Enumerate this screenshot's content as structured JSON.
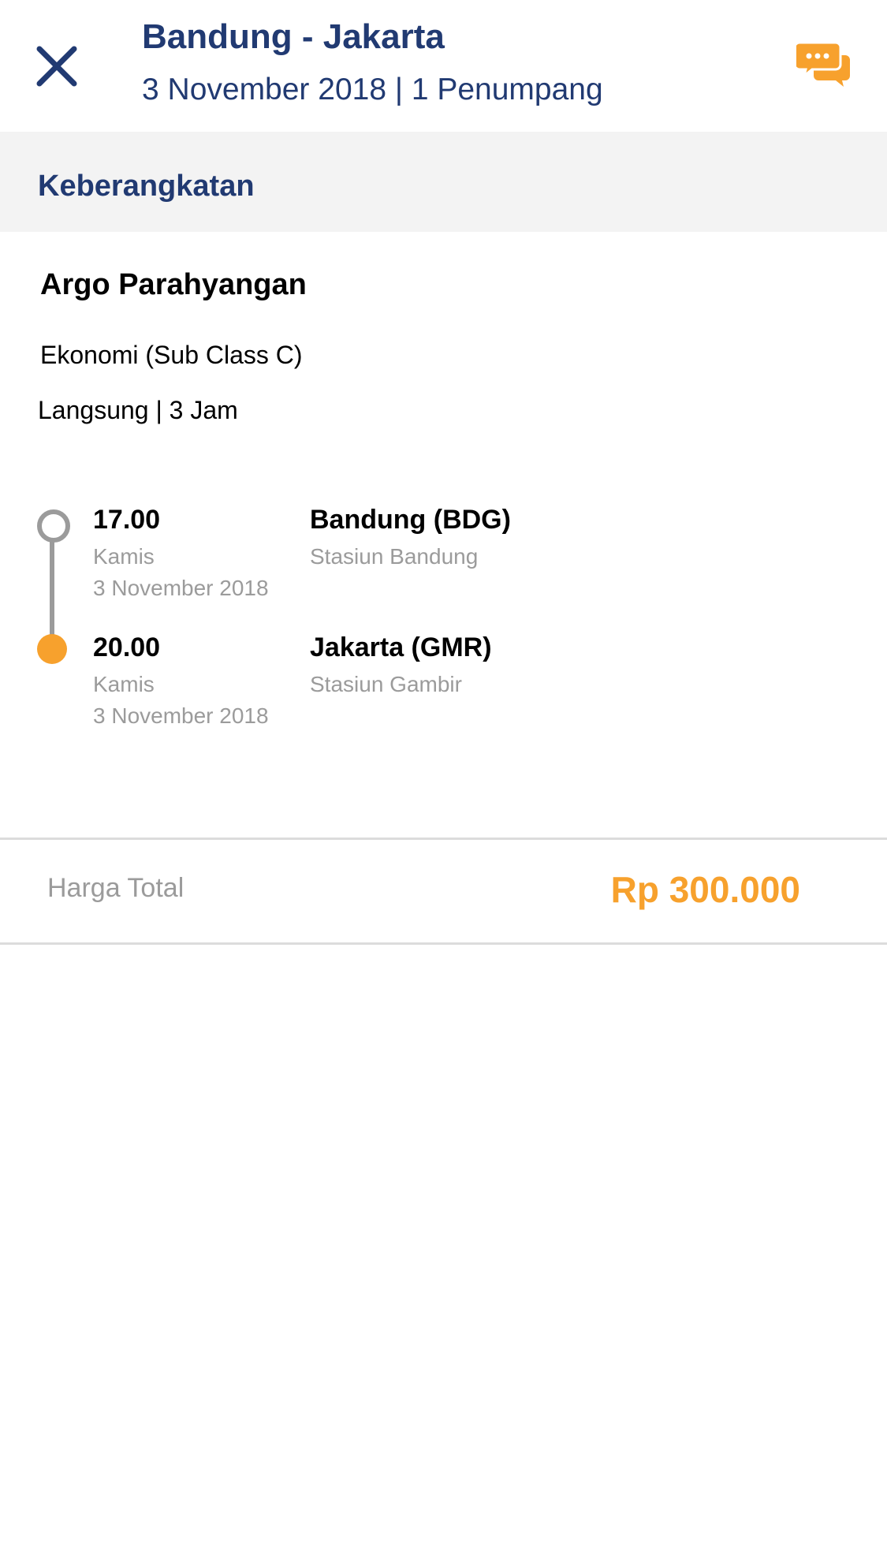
{
  "header": {
    "title": "Bandung - Jakarta",
    "subtitle": "3 November 2018 | 1 Penumpang",
    "close_icon": "close-icon",
    "chat_icon": "chat-icon"
  },
  "section": {
    "title": "Keberangkatan"
  },
  "train": {
    "name": "Argo Parahyangan",
    "class": "Ekonomi (Sub Class C)",
    "duration": "Langsung | 3 Jam"
  },
  "itinerary": {
    "departure": {
      "time": "17.00",
      "day": "Kamis",
      "date": "3 November 2018",
      "city": "Bandung (BDG)",
      "station": "Stasiun Bandung"
    },
    "arrival": {
      "time": "20.00",
      "day": "Kamis",
      "date": "3 November 2018",
      "city": "Jakarta (GMR)",
      "station": "Stasiun Gambir"
    }
  },
  "price": {
    "label": "Harga Total",
    "value": "Rp 300.000"
  },
  "colors": {
    "primary": "#213a72",
    "accent": "#f7a12d",
    "muted": "#9b9b9b",
    "band": "#f3f3f3"
  }
}
